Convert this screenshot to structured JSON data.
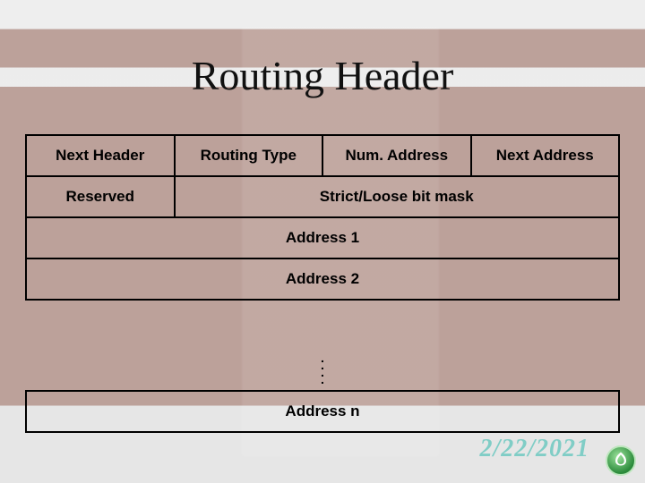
{
  "title": "Routing Header",
  "row1": {
    "c1": "Next Header",
    "c2": "Routing Type",
    "c3": "Num. Address",
    "c4": "Next Address"
  },
  "row2": {
    "c1": "Reserved",
    "c2": "Strict/Loose bit mask"
  },
  "addr1": "Address 1",
  "addr2": "Address 2",
  "addrn": "Address n",
  "date": "2/22/2021"
}
